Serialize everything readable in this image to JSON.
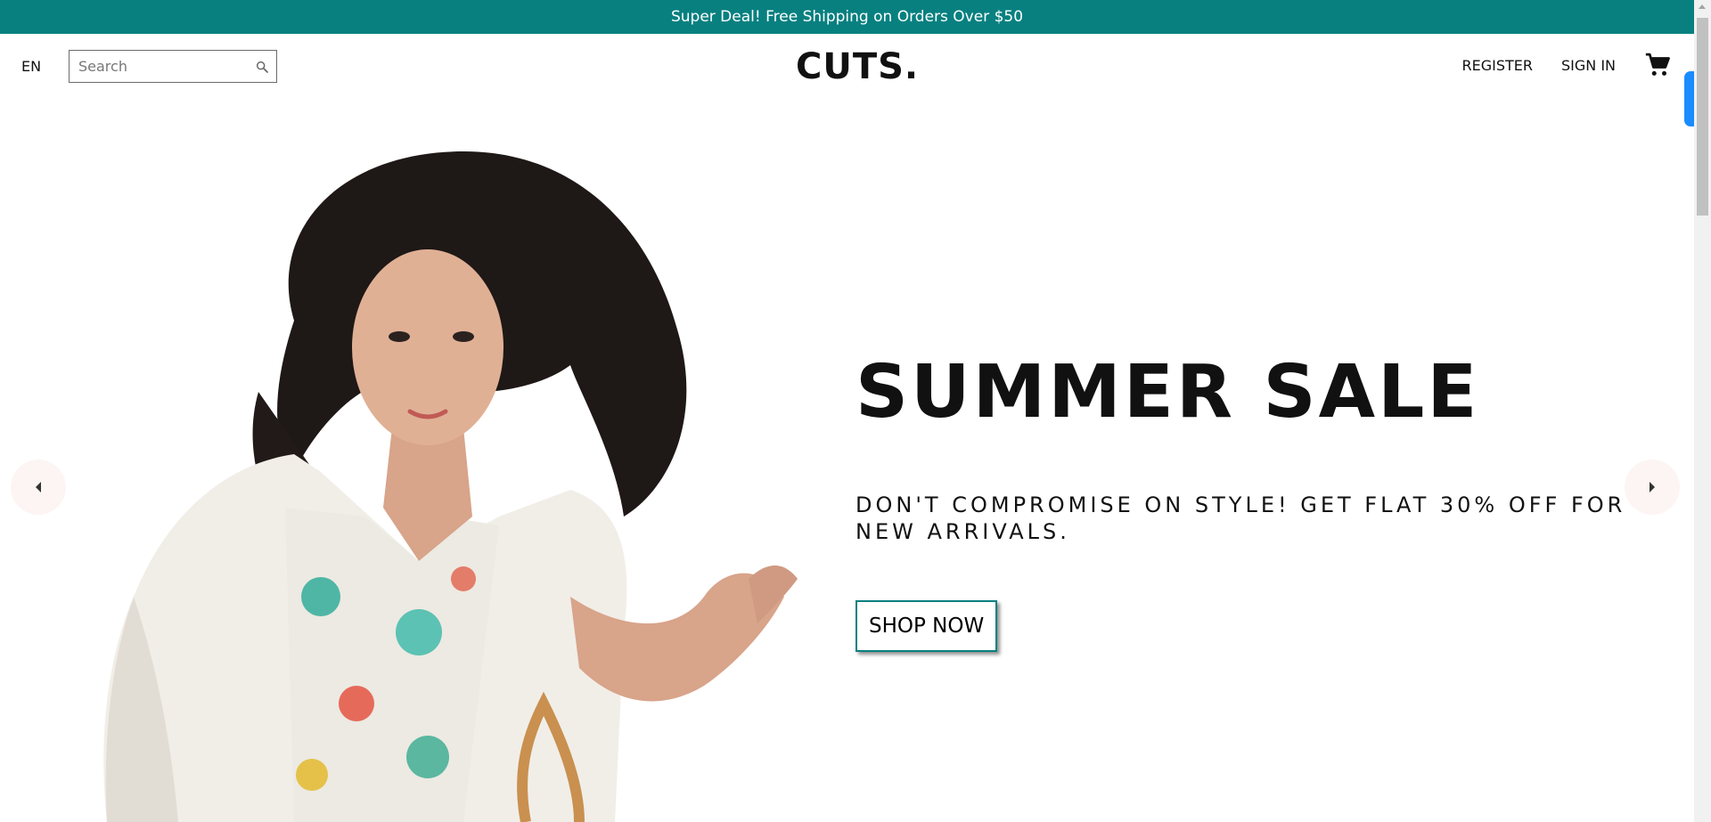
{
  "announcement": {
    "text": "Super Deal! Free Shipping on Orders Over $50",
    "background": "#088080"
  },
  "navbar": {
    "language": "EN",
    "search": {
      "placeholder": "Search",
      "value": ""
    },
    "logo": "CUTS.",
    "links": {
      "register": "REGISTER",
      "sign_in": "SIGN IN"
    },
    "icons": {
      "search": "search-icon",
      "cart": "shopping-cart-icon"
    }
  },
  "slider": {
    "slide": {
      "title": "SUMMER SALE",
      "description": "DON'T COMPROMISE ON STYLE! GET FLAT 30% OFF FOR NEW ARRIVALS.",
      "button_label": "SHOP NOW",
      "image": "Woman with long dark hair in a white jacket and floral blouse holding a tan bag"
    },
    "arrows": {
      "left": "arrow-left-icon",
      "right": "arrow-right-icon"
    },
    "arrow_background": "#fdf5f3"
  },
  "colors": {
    "accent": "#088080",
    "widget": "#1a8cff"
  }
}
